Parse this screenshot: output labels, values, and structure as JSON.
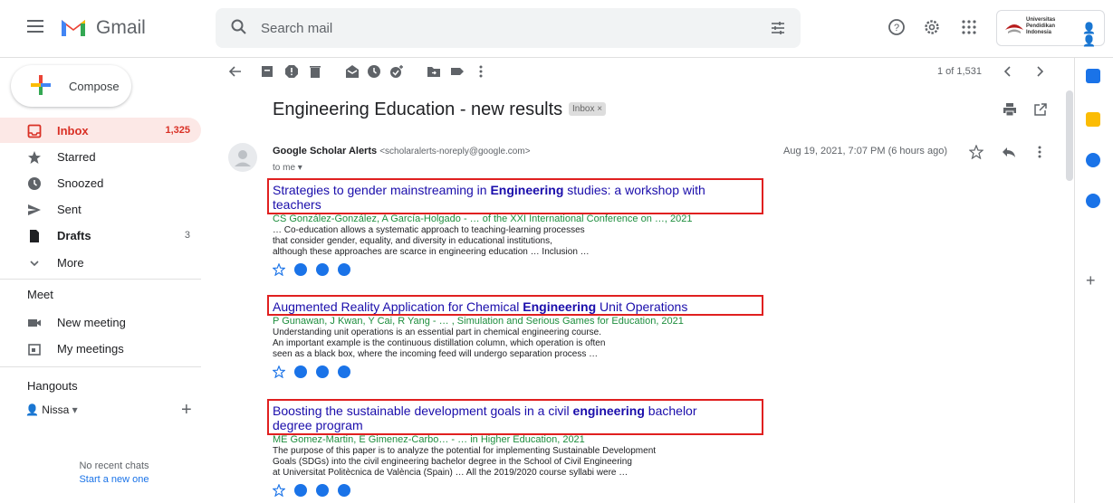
{
  "app": {
    "name": "Gmail"
  },
  "search": {
    "placeholder": "Search mail"
  },
  "org": {
    "line1": "Universitas",
    "line2": "Pendidikan",
    "line3": "Indonesia"
  },
  "compose": {
    "label": "Compose"
  },
  "nav": [
    {
      "label": "Inbox",
      "count": "1,325",
      "icon": "inbox-icon"
    },
    {
      "label": "Starred",
      "count": "",
      "icon": "star-icon"
    },
    {
      "label": "Snoozed",
      "count": "",
      "icon": "clock-icon"
    },
    {
      "label": "Sent",
      "count": "",
      "icon": "send-icon"
    },
    {
      "label": "Drafts",
      "count": "3",
      "icon": "draft-icon"
    },
    {
      "label": "More",
      "count": "",
      "icon": "chevron-down-icon"
    }
  ],
  "meet": {
    "heading": "Meet",
    "new_meeting": "New meeting",
    "my_meetings": "My meetings"
  },
  "hangouts": {
    "heading": "Hangouts",
    "user": "Nissa",
    "no_chats": "No recent chats",
    "start_new": "Start a new one"
  },
  "toolbar": {
    "pager": "1 of 1,531"
  },
  "message": {
    "subject": "Engineering Education - new results",
    "label_chip": "Inbox",
    "sender_name": "Google Scholar Alerts",
    "sender_email": "<scholaralerts-noreply@google.com>",
    "to": "to me",
    "date": "Aug 19, 2021, 7:07 PM (6 hours ago)"
  },
  "results": [
    {
      "title_line1_pre": "Strategies to gender mainstreaming in ",
      "title_line1_bold": "Engineering",
      "title_line1_post": " studies: a workshop with",
      "title_line2": "teachers",
      "authors": "CS González-González, A García-Holgado - … of the XXI International Conference on …, 2021",
      "snippet": [
        "… Co-education allows a systematic approach to teaching-learning processes",
        "that consider gender, equality, and diversity in educational institutions,",
        "although these approaches are scarce in engineering education … Inclusion …"
      ]
    },
    {
      "title_line1_pre": "Augmented Reality Application for Chemical ",
      "title_line1_bold": "Engineering",
      "title_line1_post": " Unit Operations",
      "title_line2": "",
      "authors": "P Gunawan, J Kwan, Y Cai, R Yang - … , Simulation and Serious Games for Education, 2021",
      "snippet": [
        "Understanding unit operations is an essential part in chemical engineering course.",
        "An important example is the continuous distillation column, which operation is often",
        "seen as a black box, where the incoming feed will undergo separation process …"
      ]
    },
    {
      "title_line1_pre": "Boosting the sustainable development goals in a civil ",
      "title_line1_bold": "engineering",
      "title_line1_post": " bachelor",
      "title_line2": "degree program",
      "authors": "ME Gomez-Martin, E Gimenez-Carbo… - … in Higher Education, 2021",
      "snippet": [
        "The purpose of this paper is to analyze the potential for implementing Sustainable Development",
        "Goals (SDGs) into the civil engineering bachelor degree in the School of Civil Engineering",
        "at Universitat Politècnica de València (Spain) … All the 2019/2020 course syllabi were …"
      ]
    }
  ],
  "colors": {
    "accent": "#d93025",
    "link": "#1a0dab",
    "green": "#1e8e3e",
    "highlight_box": "#e02020"
  }
}
